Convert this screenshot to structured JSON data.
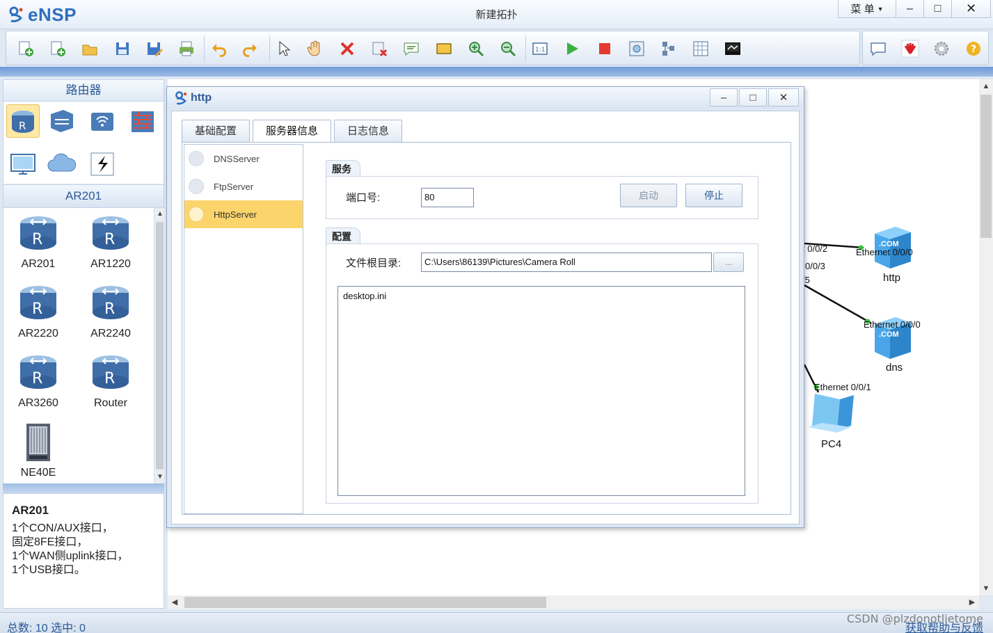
{
  "app": {
    "name": "eNSP",
    "window_title": "新建拓扑",
    "menu_label": "菜 单",
    "min_symbol": "–",
    "max_symbol": "□",
    "close_symbol": "✕"
  },
  "toolbar": {
    "icons": [
      "new-topology-icon",
      "new-blank-icon",
      "open-icon",
      "save-icon",
      "save-as-icon",
      "print-icon",
      "undo-icon",
      "redo-icon",
      "select-pointer-icon",
      "pan-hand-icon",
      "delete-icon",
      "delete-link-icon",
      "text-annotation-icon",
      "rectangle-icon",
      "zoom-in-icon",
      "zoom-out-icon",
      "fit-window-icon",
      "start-device-icon",
      "stop-device-icon",
      "capture-icon",
      "topology-layout-icon",
      "grid-icon",
      "console-icon"
    ],
    "right_icons": [
      "chat-icon",
      "huawei-logo-icon",
      "settings-gear-icon",
      "help-icon"
    ]
  },
  "left_panel": {
    "category_title": "路由器",
    "categories": [
      "router-category-icon",
      "switch-category-icon",
      "wireless-category-icon",
      "firewall-category-icon",
      "terminal-category-icon",
      "cloud-category-icon",
      "link-category-icon"
    ],
    "selected_model": "AR201",
    "devices": [
      {
        "name": "AR201"
      },
      {
        "name": "AR1220"
      },
      {
        "name": "AR2220"
      },
      {
        "name": "AR2240"
      },
      {
        "name": "AR3260"
      },
      {
        "name": "Router"
      },
      {
        "name": "NE40E"
      }
    ],
    "description": {
      "title": "AR201",
      "lines": [
        "1个CON/AUX接口，",
        "固定8FE接口，",
        "1个WAN侧uplink接口，",
        "1个USB接口。"
      ]
    }
  },
  "topology": {
    "labels": {
      "port_002": "t 0/0/2",
      "port_003": "0/0/3",
      "port_005": "/5",
      "eth_http": "Ethernet 0/0/0",
      "eth_dns": "Ethernet 0/0/0",
      "eth_pc4": "Ethernet 0/0/1"
    },
    "nodes": {
      "http": "http",
      "dns": "dns",
      "pc4": "PC4"
    },
    "server_badge": ".COM"
  },
  "dialog": {
    "title": "http",
    "tabs": [
      "基础配置",
      "服务器信息",
      "日志信息"
    ],
    "active_tab": 1,
    "servers": [
      "DNSServer",
      "FtpServer",
      "HttpServer"
    ],
    "active_server": 2,
    "service_group": "服务",
    "port_label": "端口号:",
    "port_value": "80",
    "start_label": "启动",
    "stop_label": "停止",
    "config_group": "配置",
    "root_label": "文件根目录:",
    "root_value": "C:\\Users\\86139\\Pictures\\Camera Roll",
    "browse_label": "...",
    "files": [
      "desktop.ini"
    ]
  },
  "status": {
    "summary": "总数: 10  选中: 0",
    "help_link": "获取帮助与反馈",
    "watermark": "CSDN @plzdonotlietome"
  }
}
